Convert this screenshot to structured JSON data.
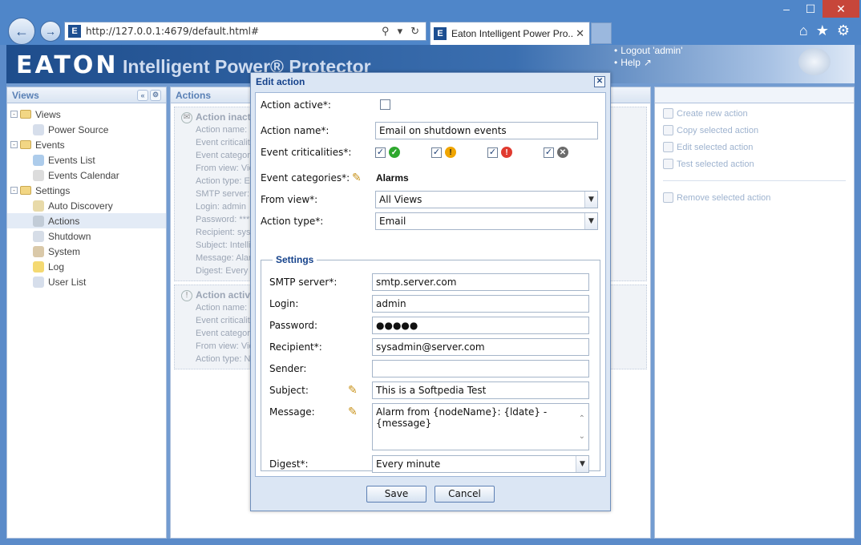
{
  "browser": {
    "url": "http://127.0.0.1:4679/default.html#",
    "tab_title": "Eaton Intelligent Power Pro...",
    "favicon_letter": "E"
  },
  "header": {
    "logo": "EATON",
    "app_title": "Intelligent Power® Protector",
    "logout": "Logout 'admin'",
    "help": "Help"
  },
  "views_panel": {
    "title": "Views",
    "tree": [
      {
        "label": "Views",
        "level": 0,
        "type": "folder",
        "toggle": "-"
      },
      {
        "label": "Power Source",
        "level": 1,
        "type": "leaf"
      },
      {
        "label": "Events",
        "level": 0,
        "type": "folder",
        "toggle": "-"
      },
      {
        "label": "Events List",
        "level": 1,
        "type": "leaf"
      },
      {
        "label": "Events Calendar",
        "level": 1,
        "type": "leaf"
      },
      {
        "label": "Settings",
        "level": 0,
        "type": "folder",
        "toggle": "-"
      },
      {
        "label": "Auto Discovery",
        "level": 1,
        "type": "leaf"
      },
      {
        "label": "Actions",
        "level": 1,
        "type": "leaf",
        "selected": true
      },
      {
        "label": "Shutdown",
        "level": 1,
        "type": "leaf"
      },
      {
        "label": "System",
        "level": 1,
        "type": "leaf"
      },
      {
        "label": "Log",
        "level": 1,
        "type": "leaf"
      },
      {
        "label": "User List",
        "level": 1,
        "type": "leaf"
      }
    ]
  },
  "actions_panel": {
    "title": "Actions",
    "card1": [
      "Action inactive",
      "Action name: Eve",
      "Event criticalities:",
      "Event categories:",
      "From view: Vie",
      "Action type: Em",
      "SMTP server: s",
      "Login: admin",
      "Password: ****",
      "Recipient: sys",
      "Subject: Intelli",
      "Message: Alar",
      "Digest: Every m"
    ],
    "card2": [
      "Action active",
      "Action name: N",
      "Event criticalitie",
      "Event categorie",
      "From view: Vie",
      "Action type: No"
    ]
  },
  "right_panel": {
    "commands": [
      "Create new action",
      "Copy selected action",
      "Edit selected action",
      "Test selected action"
    ],
    "remove": "Remove selected action"
  },
  "dialog": {
    "title": "Edit action",
    "action_active_label": "Action active*:",
    "action_name_label": "Action name*:",
    "action_name_value": "Email on shutdown events",
    "event_crit_label": "Event criticalities*:",
    "event_cat_label": "Event categories*:",
    "event_cat_value": "Alarms",
    "from_view_label": "From view*:",
    "from_view_value": "All Views",
    "action_type_label": "Action type*:",
    "action_type_value": "Email",
    "settings_legend": "Settings",
    "smtp_label": "SMTP server*:",
    "smtp_value": "smtp.server.com",
    "login_label": "Login:",
    "login_value": "admin",
    "password_label": "Password:",
    "password_value": "●●●●●",
    "recipient_label": "Recipient*:",
    "recipient_value": "sysadmin@server.com",
    "sender_label": "Sender:",
    "sender_value": "",
    "subject_label": "Subject:",
    "subject_value": "This is a Softpedia Test",
    "message_label": "Message:",
    "message_value": "Alarm from {nodeName}: {ldate} - {message}",
    "digest_label": "Digest*:",
    "digest_value": "Every minute",
    "save": "Save",
    "cancel": "Cancel"
  },
  "colors": {
    "accent": "#15428b",
    "chrome": "#4f86c9",
    "crit_ok": "#2ea82e",
    "crit_warn": "#f0a500",
    "crit_alarm": "#e03a2f",
    "crit_off": "#6b6b6b"
  }
}
